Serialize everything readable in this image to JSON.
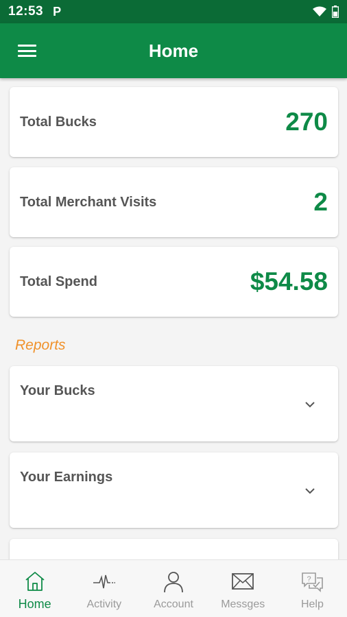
{
  "status_bar": {
    "time": "12:53",
    "notification": "P"
  },
  "app_bar": {
    "title": "Home"
  },
  "stats": [
    {
      "label": "Total Bucks",
      "value": "270"
    },
    {
      "label": "Total Merchant Visits",
      "value": "2"
    },
    {
      "label": "Total Spend",
      "value": "$54.58"
    }
  ],
  "reports": {
    "title": "Reports",
    "items": [
      {
        "label": "Your Bucks"
      },
      {
        "label": "Your Earnings"
      }
    ]
  },
  "bottom_nav": [
    {
      "label": "Home",
      "icon": "home-icon",
      "active": true
    },
    {
      "label": "Activity",
      "icon": "activity-icon",
      "active": false
    },
    {
      "label": "Account",
      "icon": "account-icon",
      "active": false
    },
    {
      "label": "Messges",
      "icon": "mail-icon",
      "active": false
    },
    {
      "label": "Help",
      "icon": "help-icon",
      "active": false
    }
  ],
  "colors": {
    "primary": "#0e8a47",
    "status_bar": "#0b6b36",
    "accent": "#f0912a",
    "text": "#555555",
    "inactive": "#9a9a9a"
  }
}
